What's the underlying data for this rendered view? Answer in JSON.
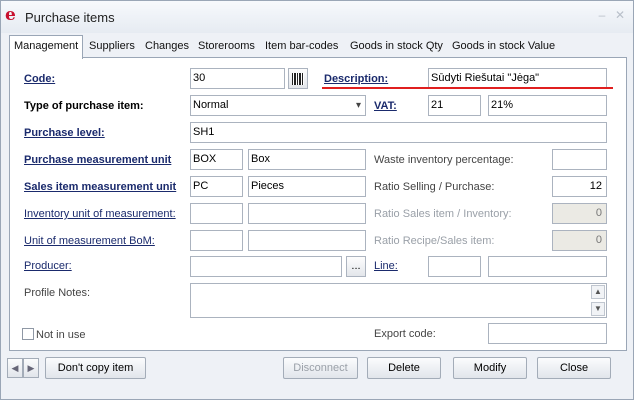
{
  "window": {
    "title": "Purchase items",
    "app_icon": "e"
  },
  "tabs": [
    {
      "label": "Management",
      "active": true
    },
    {
      "label": "Suppliers"
    },
    {
      "label": "Changes"
    },
    {
      "label": "Storerooms"
    },
    {
      "label": "Item bar-codes"
    },
    {
      "label": "Goods in stock Qty"
    },
    {
      "label": "Goods in stock Value"
    }
  ],
  "form": {
    "code_label": "Code:",
    "code_value": "30",
    "description_label": "Description:",
    "description_value": "Sūdyti Riešutai \"Jėga\"",
    "type_label": "Type of purchase item:",
    "type_value": "Normal",
    "vat_label": "VAT:",
    "vat_code": "21",
    "vat_percent": "21%",
    "purchase_level_label": "Purchase level:",
    "purchase_level_value": "SH1",
    "purchase_unit_label": "Purchase measurement unit",
    "purchase_unit_code": "BOX",
    "purchase_unit_name": "Box",
    "waste_label": "Waste inventory percentage:",
    "waste_value": "",
    "sales_unit_label": "Sales item measurement unit",
    "sales_unit_code": "PC",
    "sales_unit_name": "Pieces",
    "ratio_sp_label": "Ratio Selling / Purchase:",
    "ratio_sp_value": "12",
    "inventory_unit_label": "Inventory unit of measurement:",
    "ratio_si_label": "Ratio Sales item / Inventory:",
    "ratio_si_value": "0",
    "bom_unit_label": "Unit of measurement BoM:",
    "ratio_rs_label": "Ratio Recipe/Sales item:",
    "ratio_rs_value": "0",
    "producer_label": "Producer:",
    "producer_button": "...",
    "line_label": "Line:",
    "profile_notes_label": "Profile Notes:",
    "not_in_use_label": "Not in use",
    "export_code_label": "Export code:"
  },
  "footer": {
    "dont_copy": "Don't copy item",
    "disconnect": "Disconnect",
    "delete": "Delete",
    "modify": "Modify",
    "close": "Close"
  },
  "colors": {
    "accent_red": "#e01f1f",
    "link_blue": "#1a2a6c"
  }
}
